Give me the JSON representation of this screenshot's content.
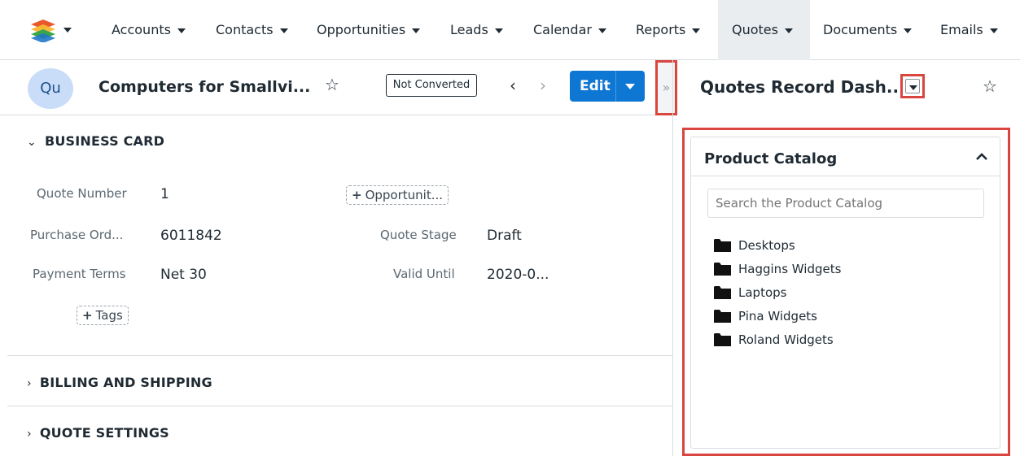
{
  "nav": {
    "items": [
      {
        "label": "Accounts"
      },
      {
        "label": "Contacts"
      },
      {
        "label": "Opportunities"
      },
      {
        "label": "Leads"
      },
      {
        "label": "Calendar"
      },
      {
        "label": "Reports"
      },
      {
        "label": "Quotes",
        "active": true
      },
      {
        "label": "Documents"
      },
      {
        "label": "Emails"
      }
    ]
  },
  "record": {
    "avatar": "Qu",
    "title": "Computers for Smallvi...",
    "status_badge": "Not Converted",
    "edit_label": "Edit",
    "toggle_glyph": "»"
  },
  "sections": {
    "business_card": {
      "title": "BUSINESS CARD",
      "fields": {
        "quote_number_label": "Quote Number",
        "quote_number_value": "1",
        "opportunity_button": "Opportunit...",
        "purchase_order_label": "Purchase Ord...",
        "purchase_order_value": "6011842",
        "quote_stage_label": "Quote Stage",
        "quote_stage_value": "Draft",
        "payment_terms_label": "Payment Terms",
        "payment_terms_value": "Net 30",
        "valid_until_label": "Valid Until",
        "valid_until_value": "2020-0...",
        "tags_button": "Tags"
      }
    },
    "billing_shipping": {
      "title": "BILLING AND SHIPPING"
    },
    "quote_settings": {
      "title": "QUOTE SETTINGS"
    }
  },
  "dashboard": {
    "title": "Quotes Record Dash...",
    "dashlet": {
      "title": "Product Catalog",
      "search_placeholder": "Search the Product Catalog",
      "categories": [
        "Desktops",
        "Haggins Widgets",
        "Laptops",
        "Pina Widgets",
        "Roland Widgets"
      ]
    }
  },
  "colors": {
    "brand_blue": "#0e76d3",
    "highlight_red": "#d9453f",
    "avatar_bg": "#c9ddf8"
  },
  "icons": {
    "logo": "stacked-layers-icon",
    "star": "star-outline-icon",
    "folder": "folder-icon",
    "collapse": "chevron-up-icon"
  }
}
